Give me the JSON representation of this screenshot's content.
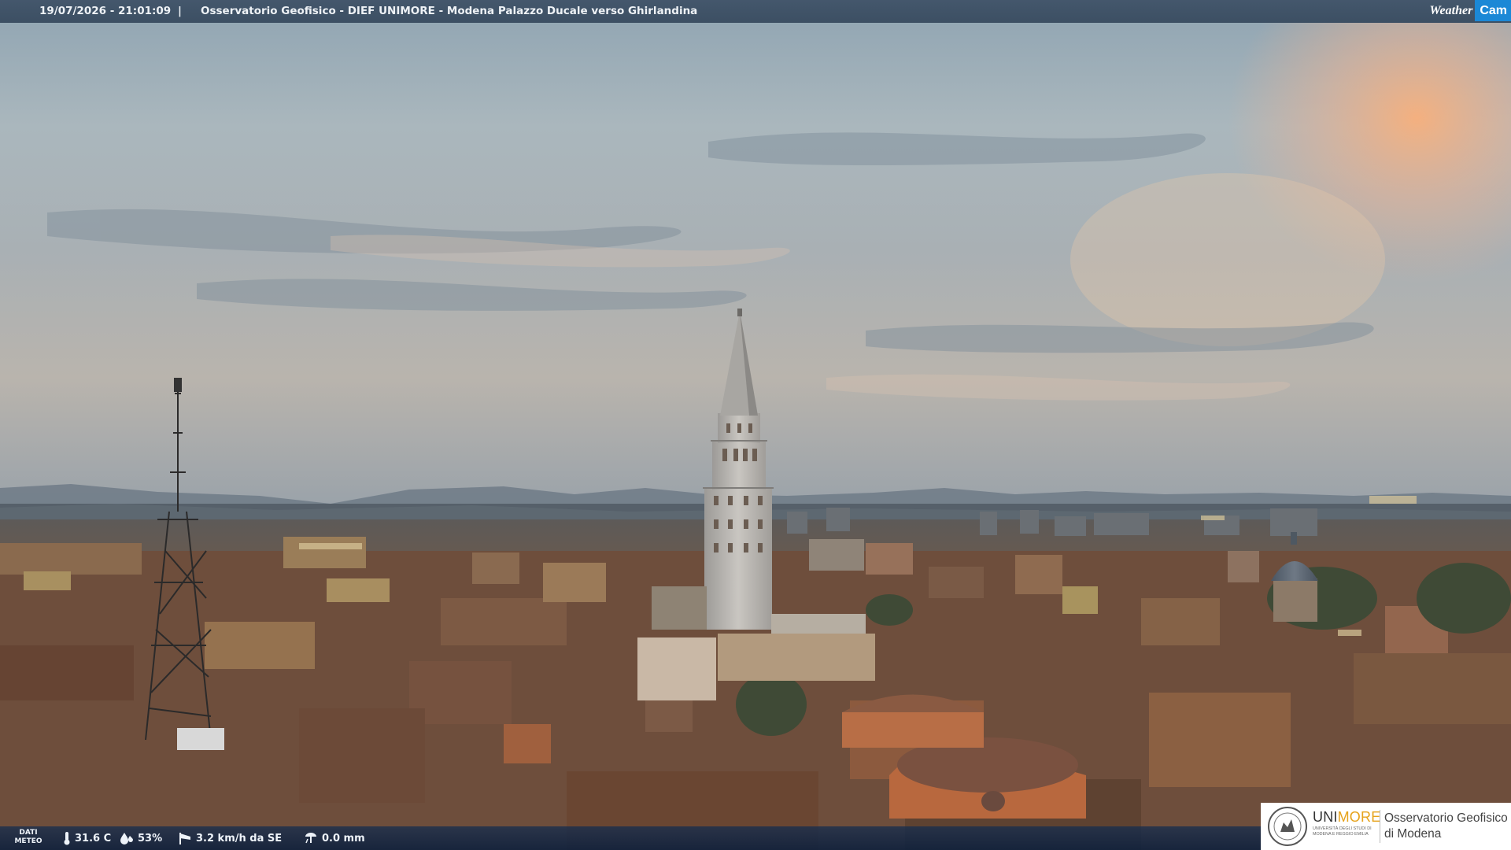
{
  "header": {
    "timestamp": "19/07/2026 - 21:01:09",
    "separator": "|",
    "title": "Osservatorio Geofisico - DIEF UNIMORE - Modena Palazzo Ducale verso Ghirlandina",
    "brand_weather": "Weather",
    "brand_cam": "Cam"
  },
  "weather": {
    "label_line1": "DATI",
    "label_line2": "METEO",
    "temperature": "31.6 C",
    "humidity": "53%",
    "wind": "3.2 km/h da SE",
    "rain": "0.0 mm"
  },
  "logo": {
    "uni_prefix": "UNI",
    "uni_suffix": "MORE",
    "uni_sub1": "UNIVERSITÀ DEGLI STUDI DI",
    "uni_sub2": "MODENA E REGGIO EMILIA",
    "obs_line1": "Osservatorio Geofisico",
    "obs_line2": "di Modena"
  },
  "colors": {
    "topbar_bg": "#3f5266",
    "bottombar_bg": "#182e4e",
    "cam_accent": "#1b88d6",
    "unimore_accent": "#e6a21a"
  },
  "icons": {
    "temperature": "thermometer-icon",
    "humidity": "drop-icon",
    "wind": "wind-sock-icon",
    "rain": "rain-gauge-icon"
  }
}
